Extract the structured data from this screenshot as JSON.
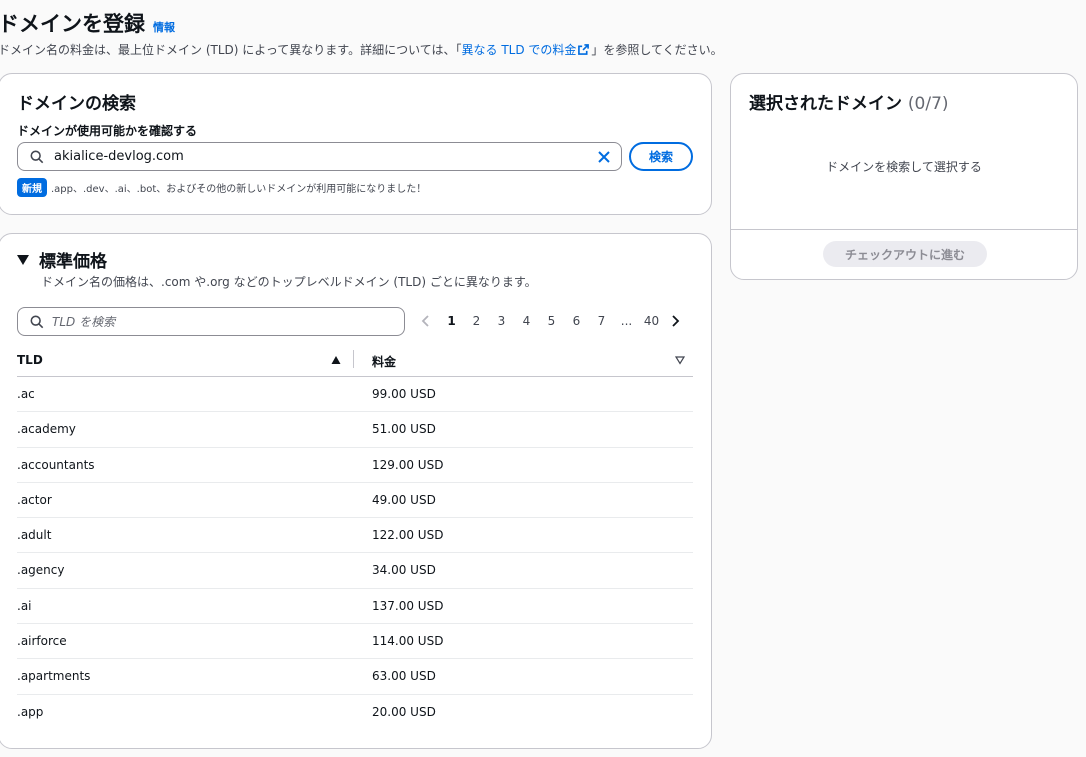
{
  "header": {
    "title": "ドメインを登録",
    "info_link": "情報",
    "subtitle_before": "ドメイン名の料金は、最上位ドメイン (TLD) によって異なります。詳細については、「",
    "subtitle_link": "異なる TLD での料金",
    "subtitle_after": "」を参照してください。"
  },
  "search": {
    "title": "ドメインの検索",
    "label": "ドメインが使用可能かを確認する",
    "value": "akialice-devlog.com",
    "button": "検索",
    "new_badge": "新規",
    "new_text": ".app、.dev、.ai、.bot、およびその他の新しいドメインが利用可能になりました！"
  },
  "selected": {
    "title": "選択されたドメイン",
    "count": "(0/7)",
    "empty_text": "ドメインを検索して選択する",
    "checkout_button": "チェックアウトに進む"
  },
  "pricing": {
    "title": "標準価格",
    "description": "ドメイン名の価格は、.com や.org などのトップレベルドメイン (TLD) ごとに異なります。",
    "filter_placeholder": "TLD を検索",
    "pagination": {
      "pages": [
        "1",
        "2",
        "3",
        "4",
        "5",
        "6",
        "7",
        "...",
        "40"
      ],
      "current": "1"
    },
    "columns": {
      "tld": "TLD",
      "price": "料金"
    },
    "rows": [
      {
        "tld": ".ac",
        "price": "99.00 USD"
      },
      {
        "tld": ".academy",
        "price": "51.00 USD"
      },
      {
        "tld": ".accountants",
        "price": "129.00 USD"
      },
      {
        "tld": ".actor",
        "price": "49.00 USD"
      },
      {
        "tld": ".adult",
        "price": "122.00 USD"
      },
      {
        "tld": ".agency",
        "price": "34.00 USD"
      },
      {
        "tld": ".ai",
        "price": "137.00 USD"
      },
      {
        "tld": ".airforce",
        "price": "114.00 USD"
      },
      {
        "tld": ".apartments",
        "price": "63.00 USD"
      },
      {
        "tld": ".app",
        "price": "20.00 USD"
      }
    ]
  },
  "colors": {
    "accent": "#006ce0",
    "border": "#c6c6cd",
    "text": "#0f141a",
    "muted": "#424650"
  }
}
